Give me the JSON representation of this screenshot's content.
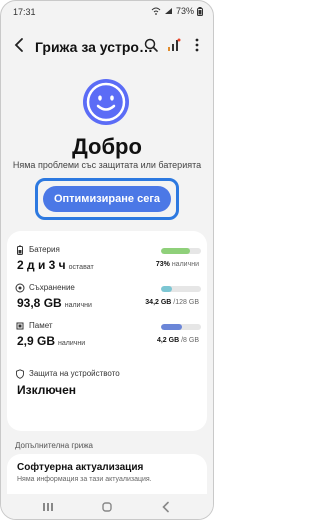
{
  "statusbar": {
    "time": "17:31",
    "battery": "73%"
  },
  "appbar": {
    "title": "Грижа за устро…"
  },
  "status": {
    "title": "Добро",
    "subtitle": "Няма проблеми със защитата или батерията",
    "face_color": "#5b6cf6"
  },
  "optimize": {
    "label": "Оптимизиране сега",
    "highlight_color": "#2d79e0",
    "button_color": "#4b78e6"
  },
  "metrics": [
    {
      "label": "Батерия",
      "value": "2 д и 3 ч",
      "unit": "остават",
      "meta_bold": "73%",
      "meta_rest": " налични",
      "bar_fraction": 0.73,
      "bar_color": "#8fd07a",
      "icon": "battery-icon"
    },
    {
      "label": "Съхранение",
      "value": "93,8 GB",
      "unit": "налични",
      "meta_bold": "34,2 GB",
      "meta_rest": " /128 GB",
      "bar_fraction": 0.27,
      "bar_color": "#7cc6d3",
      "icon": "storage-icon"
    },
    {
      "label": "Памет",
      "value": "2,9 GB",
      "unit": "налични",
      "meta_bold": "4,2 GB",
      "meta_rest": " /8 GB",
      "bar_fraction": 0.53,
      "bar_color": "#6b86d8",
      "icon": "memory-icon"
    }
  ],
  "protection": {
    "label": "Защита на устройството",
    "value": "Изключен",
    "icon": "shield-icon"
  },
  "extra": {
    "heading": "Допълнителна грижа",
    "item_title": "Софтуерна актуализация",
    "item_sub": "Няма информация за тази актуализация."
  }
}
